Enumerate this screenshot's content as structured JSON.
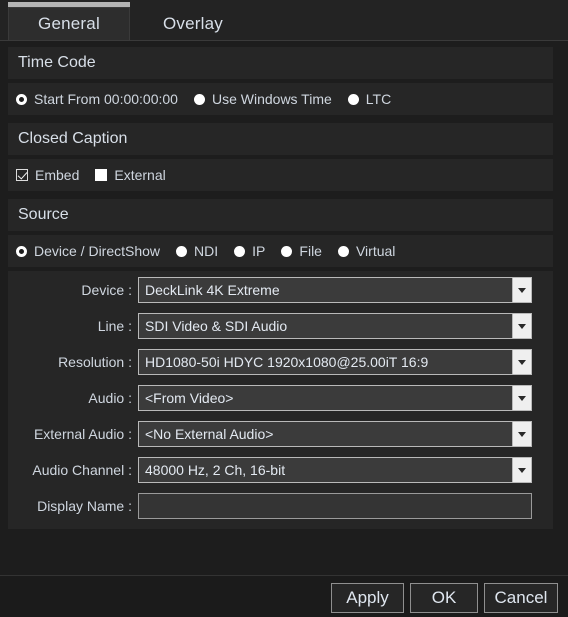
{
  "tabs": [
    {
      "label": "General",
      "active": true
    },
    {
      "label": "Overlay",
      "active": false
    }
  ],
  "sections": {
    "timecode": {
      "header": "Time Code",
      "options": [
        {
          "label": "Start From 00:00:00:00",
          "selected": true
        },
        {
          "label": "Use Windows Time",
          "selected": false
        },
        {
          "label": "LTC",
          "selected": false
        }
      ]
    },
    "closed_caption": {
      "header": "Closed Caption",
      "options": [
        {
          "label": "Embed",
          "checked": true
        },
        {
          "label": "External",
          "checked": false
        }
      ]
    },
    "source": {
      "header": "Source",
      "options": [
        {
          "label": "Device / DirectShow",
          "selected": true
        },
        {
          "label": "NDI",
          "selected": false
        },
        {
          "label": "IP",
          "selected": false
        },
        {
          "label": "File",
          "selected": false
        },
        {
          "label": "Virtual",
          "selected": false
        }
      ],
      "fields": [
        {
          "label": "Device :",
          "value": "DeckLink 4K Extreme",
          "type": "combo"
        },
        {
          "label": "Line :",
          "value": "SDI Video & SDI Audio",
          "type": "combo"
        },
        {
          "label": "Resolution :",
          "value": "HD1080-50i HDYC 1920x1080@25.00iT 16:9",
          "type": "combo"
        },
        {
          "label": "Audio :",
          "value": "<From Video>",
          "type": "combo"
        },
        {
          "label": "External Audio :",
          "value": "<No External Audio>",
          "type": "combo"
        },
        {
          "label": "Audio Channel :",
          "value": "48000 Hz, 2 Ch, 16-bit",
          "type": "combo"
        },
        {
          "label": "Display Name :",
          "value": "",
          "type": "text"
        }
      ]
    }
  },
  "buttons": {
    "apply": "Apply",
    "ok": "OK",
    "cancel": "Cancel"
  },
  "colors": {
    "background": "#1b1b1b",
    "panel": "#1d1d1d",
    "row": "#262626",
    "combo_field": "#3b3b3b",
    "combo_button": "#efefef",
    "text": "#d6dde6",
    "tab_accent": "#b4b4b4"
  }
}
